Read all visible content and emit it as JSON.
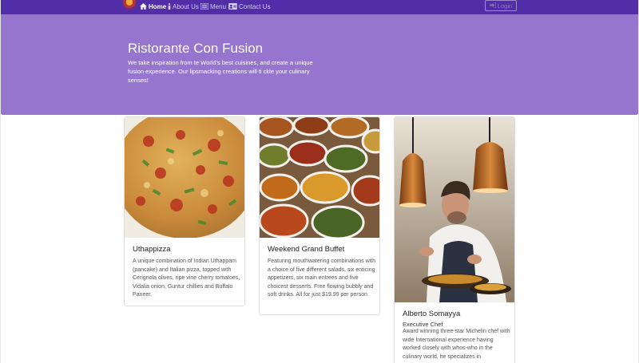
{
  "navbar": {
    "items": [
      {
        "label": "Home",
        "icon": "home-icon",
        "active": true
      },
      {
        "label": "About Us",
        "icon": "info-icon",
        "active": false
      },
      {
        "label": "Menu",
        "icon": "list-icon",
        "active": false
      },
      {
        "label": "Contact Us",
        "icon": "address-card-icon",
        "active": false
      }
    ],
    "login_label": "Login",
    "colors": {
      "bar": "#512DA8",
      "active_text": "#ffffff",
      "text": "#d6ccf0"
    }
  },
  "jumbotron": {
    "title": "Ristorante Con Fusion",
    "text": "We take inspiration from te World's best cuisines, and create a unique fusion experience. Our lipsmacking creations will ti ckle your culinary senses!",
    "color": "#9575CD"
  },
  "cards": [
    {
      "title": "Uthappizza",
      "image": "pizza-photo",
      "text": "A unique combination of Indian Uthappam (pancake) and Italian pizza, topped with Cerignola olives, ripe vine cherry tomatoes, Vidalia onion, Guntur chillies and Buffalo Paneer."
    },
    {
      "title": "Weekend Grand Buffet",
      "image": "buffet-photo",
      "text": "Featuring mouthwatering combinations with a choice of five different salads, six enticing appetizers, six main entrees and five choicest desserts. Free flowing bubbly and soft drinks. All for just $19.99 per person"
    },
    {
      "title": "Alberto Somayya",
      "subtitle": "Executive Chef",
      "image": "chef-photo",
      "text": "Award winning three-star Michelin chef with wide International experience having worked closely with whos-who in the culinary world, he specializes in"
    }
  ]
}
